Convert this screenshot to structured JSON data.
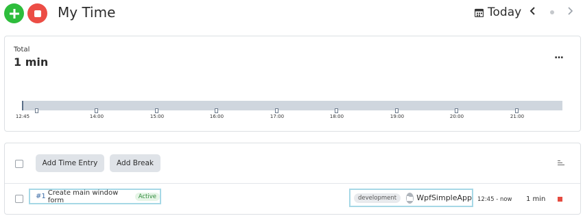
{
  "header": {
    "title": "My Time",
    "date_label": "Today",
    "prev_icon": "chevron-left",
    "next_icon": "chevron-right"
  },
  "summary": {
    "total_label": "Total",
    "total_value": "1 min",
    "menu_label": "...",
    "timeline": {
      "start_label": "12:45",
      "hour_labels": [
        "14:00",
        "15:00",
        "16:00",
        "17:00",
        "18:00",
        "19:00",
        "20:00",
        "21:00"
      ]
    }
  },
  "toolbar": {
    "add_entry_label": "Add Time Entry",
    "add_break_label": "Add Break"
  },
  "entry": {
    "number": "#1",
    "title": "Create main window form",
    "status": "Active",
    "tag": "development",
    "project": "WpfSimpleApp",
    "time_range": "12:45 - now",
    "duration": "1 min"
  },
  "colors": {
    "add": "#2ebd3c",
    "stop": "#ec4d45",
    "highlight": "#a6d8e6",
    "timeline_bar": "#cfd6de"
  }
}
